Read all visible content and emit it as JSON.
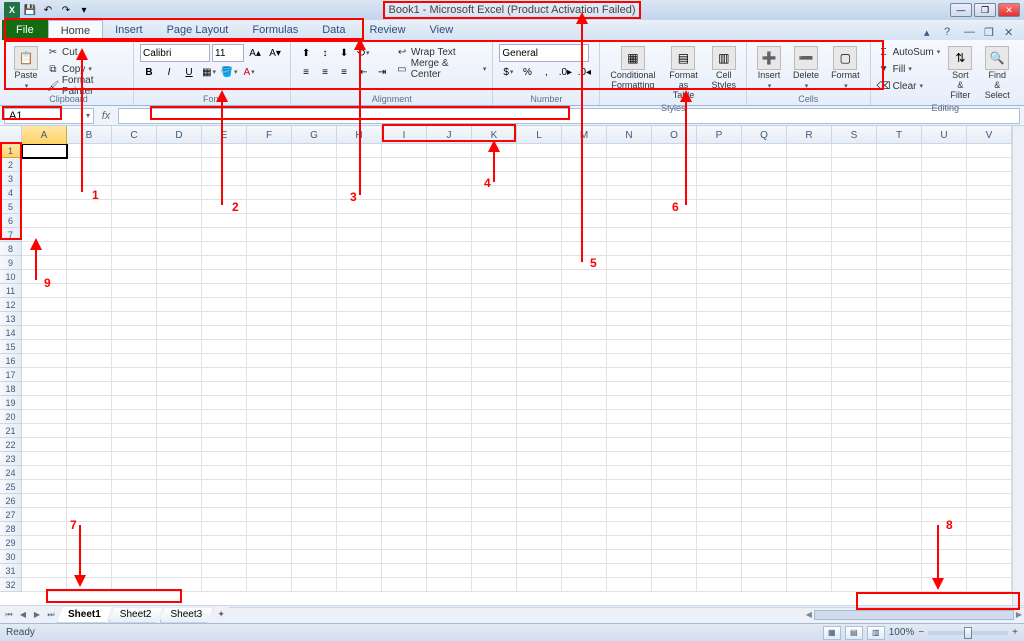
{
  "title_bar": {
    "app_title": "Book1 - Microsoft Excel (Product Activation Failed)"
  },
  "ribbon_tabs": {
    "file": "File",
    "tabs": [
      "Home",
      "Insert",
      "Page Layout",
      "Formulas",
      "Data",
      "Review",
      "View"
    ],
    "active_index": 0
  },
  "clipboard": {
    "paste": "Paste",
    "cut": "Cut",
    "copy": "Copy",
    "format_painter": "Format Painter",
    "group_label": "Clipboard"
  },
  "font": {
    "name": "Calibri",
    "size": "11",
    "bold": "B",
    "italic": "I",
    "underline": "U",
    "group_label": "Font"
  },
  "alignment": {
    "wrap_text": "Wrap Text",
    "merge_center": "Merge & Center",
    "group_label": "Alignment"
  },
  "number": {
    "format": "General",
    "group_label": "Number"
  },
  "styles": {
    "conditional": "Conditional\nFormatting",
    "format_table": "Format\nas Table",
    "cell_styles": "Cell\nStyles",
    "group_label": "Styles"
  },
  "cells_group": {
    "insert": "Insert",
    "delete": "Delete",
    "format": "Format",
    "group_label": "Cells"
  },
  "editing": {
    "autosum": "AutoSum",
    "fill": "Fill",
    "clear": "Clear",
    "sort_filter": "Sort &\nFilter",
    "find_select": "Find &\nSelect",
    "group_label": "Editing"
  },
  "formula_bar": {
    "name_box": "A1",
    "fx": "fx",
    "formula": ""
  },
  "columns": [
    "A",
    "B",
    "C",
    "D",
    "E",
    "F",
    "G",
    "H",
    "I",
    "J",
    "K",
    "L",
    "M",
    "N",
    "O",
    "P",
    "Q",
    "R",
    "S",
    "T",
    "U",
    "V"
  ],
  "row_count": 32,
  "active_cell": "A1",
  "sheets": {
    "tabs": [
      "Sheet1",
      "Sheet2",
      "Sheet3"
    ],
    "active_index": 0
  },
  "status_bar": {
    "ready": "Ready",
    "zoom": "100%"
  },
  "annotations": {
    "labels": [
      "1",
      "2",
      "3",
      "4",
      "5",
      "6",
      "7",
      "8",
      "9"
    ]
  }
}
